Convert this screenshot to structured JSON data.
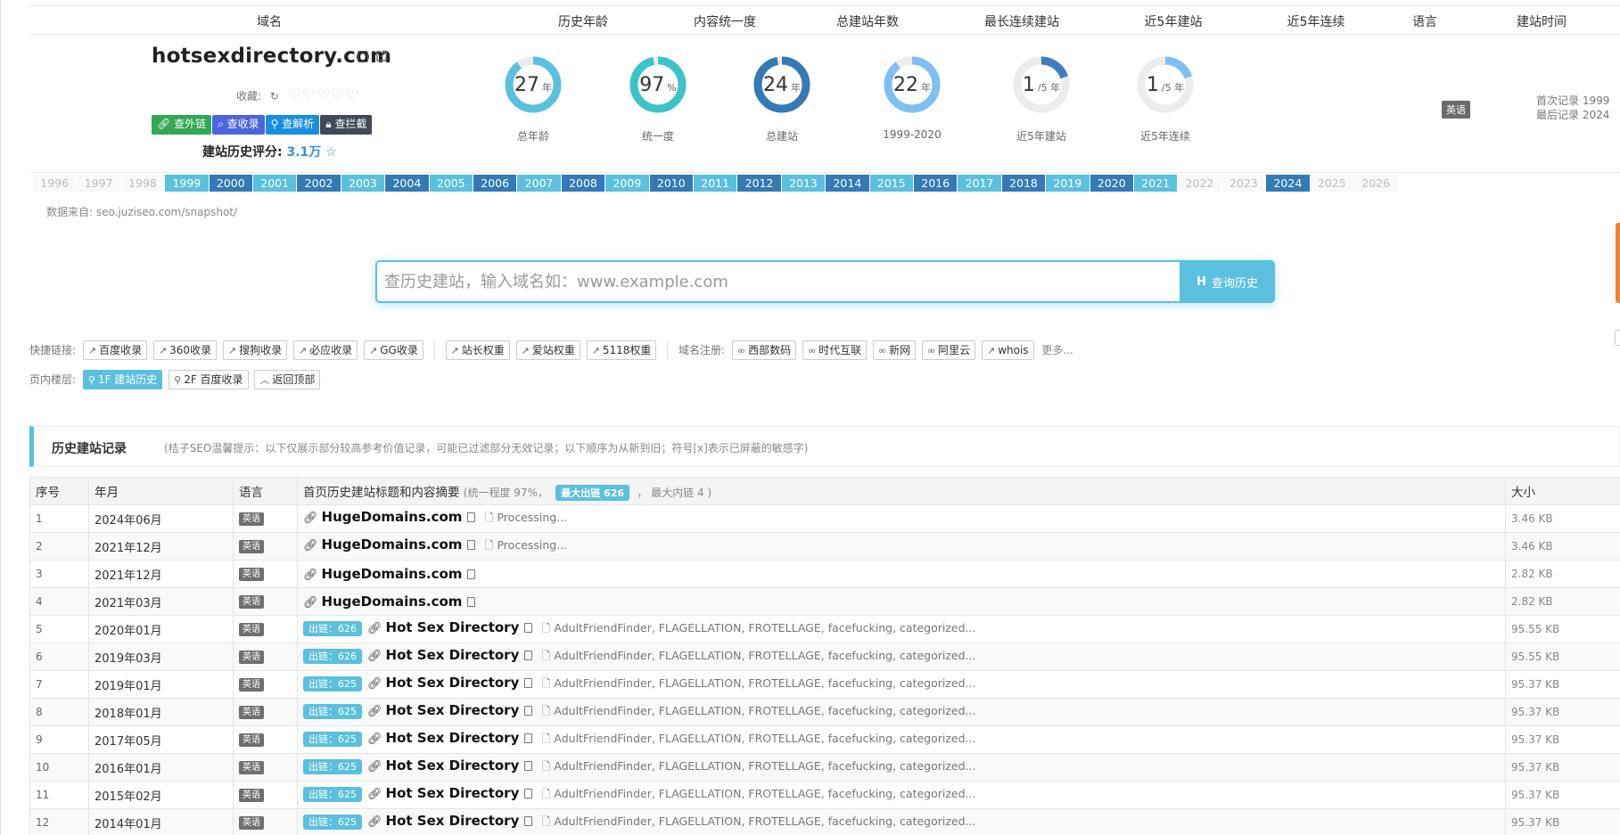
{
  "header": {
    "columns": [
      "域名",
      "历史年龄",
      "内容统一度",
      "总建站年数",
      "最长连续建站",
      "近5年建站",
      "近5年连续",
      "语言",
      "建站时间"
    ],
    "domain": "hotsexdirectory.com",
    "fav_label": "收藏:",
    "hearts": "♡♡♡♡♡",
    "buttons": [
      "查外链",
      "查收录",
      "查解析",
      "查拦截"
    ],
    "score_label": "建站历史评分:",
    "score_value": "3.1万",
    "stats": [
      {
        "num": "27",
        "unit": "年",
        "caption": "总年龄",
        "fraction": 0.9,
        "color": "#5bc0de"
      },
      {
        "num": "97",
        "unit": "%",
        "caption": "统一度",
        "fraction": 0.97,
        "color": "#3cc3c8"
      },
      {
        "num": "24",
        "unit": "年",
        "caption": "总建站",
        "fraction": 0.97,
        "color": "#337ab7"
      },
      {
        "num": "22",
        "unit": "年",
        "caption": "1999-2020",
        "fraction": 0.9,
        "color": "#7fc0f2"
      },
      {
        "num": "1",
        "unit": "/5 年",
        "caption": "近5年建站",
        "fraction": 0.2,
        "color": "#3d7fc2"
      },
      {
        "num": "1",
        "unit": "/5 年",
        "caption": "近5年连续",
        "fraction": 0.2,
        "color": "#7fc0f2"
      }
    ],
    "language": "英语",
    "first_record": "首次记录 1999",
    "last_record": "最后记录 2024"
  },
  "years": [
    {
      "y": "1996",
      "s": "off"
    },
    {
      "y": "1997",
      "s": "off"
    },
    {
      "y": "1998",
      "s": "off"
    },
    {
      "y": "1999",
      "s": "l"
    },
    {
      "y": "2000",
      "s": "d"
    },
    {
      "y": "2001",
      "s": "l"
    },
    {
      "y": "2002",
      "s": "d"
    },
    {
      "y": "2003",
      "s": "l"
    },
    {
      "y": "2004",
      "s": "d"
    },
    {
      "y": "2005",
      "s": "l"
    },
    {
      "y": "2006",
      "s": "d"
    },
    {
      "y": "2007",
      "s": "l"
    },
    {
      "y": "2008",
      "s": "d"
    },
    {
      "y": "2009",
      "s": "l"
    },
    {
      "y": "2010",
      "s": "d"
    },
    {
      "y": "2011",
      "s": "l"
    },
    {
      "y": "2012",
      "s": "d"
    },
    {
      "y": "2013",
      "s": "l"
    },
    {
      "y": "2014",
      "s": "d"
    },
    {
      "y": "2015",
      "s": "l"
    },
    {
      "y": "2016",
      "s": "d"
    },
    {
      "y": "2017",
      "s": "l"
    },
    {
      "y": "2018",
      "s": "d"
    },
    {
      "y": "2019",
      "s": "l"
    },
    {
      "y": "2020",
      "s": "d"
    },
    {
      "y": "2021",
      "s": "l"
    },
    {
      "y": "2022",
      "s": "off"
    },
    {
      "y": "2023",
      "s": "off"
    },
    {
      "y": "2024",
      "s": "d"
    },
    {
      "y": "2025",
      "s": "off"
    },
    {
      "y": "2026",
      "s": "off"
    }
  ],
  "source": "数据来自: seo.juziseo.com/snapshot/",
  "search": {
    "placeholder": "查历史建站，输入域名如：www.example.com",
    "button": "查询历史"
  },
  "quick": {
    "label": "快捷链接:",
    "group1": [
      "百度收录",
      "360收录",
      "搜狗收录",
      "必应收录",
      "GG收录"
    ],
    "group2": [
      "站长权重",
      "爱站权重",
      "5118权重"
    ],
    "reg_label": "域名注册:",
    "group3": [
      "西部数码",
      "时代互联",
      "新网",
      "阿里云",
      "whois"
    ],
    "more": "更多..."
  },
  "floors": {
    "label": "页内楼层:",
    "items": [
      "1F 建站历史",
      "2F 百度收录",
      "返回顶部"
    ]
  },
  "section": {
    "title": "历史建站记录",
    "tip": "(桔子SEO温馨提示：以下仅展示部分较高参考价值记录，可能已过滤部分无效记录；以下顺序为从新到旧；符号[x]表示已屏蔽的敏感字)"
  },
  "table": {
    "headers": [
      "序号",
      "年月",
      "语言",
      "首页历史建站标题和内容摘要",
      "大小"
    ],
    "header_sub1": "(统一程度 97%，",
    "header_badge": "最大出链 626",
    "header_sub2": "，  最大内链 4 )",
    "rows": [
      {
        "n": "1",
        "date": "2024年06月",
        "lang": "英语",
        "out": "",
        "title": "HugeDomains.com",
        "summary": "Processing...",
        "size": "3.46 KB"
      },
      {
        "n": "2",
        "date": "2021年12月",
        "lang": "英语",
        "out": "",
        "title": "HugeDomains.com",
        "summary": "Processing...",
        "size": "3.46 KB"
      },
      {
        "n": "3",
        "date": "2021年12月",
        "lang": "英语",
        "out": "",
        "title": "HugeDomains.com",
        "summary": "",
        "size": "2.82 KB"
      },
      {
        "n": "4",
        "date": "2021年03月",
        "lang": "英语",
        "out": "",
        "title": "HugeDomains.com",
        "summary": "",
        "size": "2.82 KB"
      },
      {
        "n": "5",
        "date": "2020年01月",
        "lang": "英语",
        "out": "出链：626",
        "title": "Hot Sex Directory",
        "summary": "AdultFriendFinder, FLAGELLATION, FROTELLAGE, facefucking, categorized...",
        "size": "95.55 KB"
      },
      {
        "n": "6",
        "date": "2019年03月",
        "lang": "英语",
        "out": "出链：626",
        "title": "Hot Sex Directory",
        "summary": "AdultFriendFinder, FLAGELLATION, FROTELLAGE, facefucking, categorized...",
        "size": "95.55 KB"
      },
      {
        "n": "7",
        "date": "2019年01月",
        "lang": "英语",
        "out": "出链：625",
        "title": "Hot Sex Directory",
        "summary": "AdultFriendFinder, FLAGELLATION, FROTELLAGE, facefucking, categorized...",
        "size": "95.37 KB"
      },
      {
        "n": "8",
        "date": "2018年01月",
        "lang": "英语",
        "out": "出链：625",
        "title": "Hot Sex Directory",
        "summary": "AdultFriendFinder, FLAGELLATION, FROTELLAGE, facefucking, categorized...",
        "size": "95.37 KB"
      },
      {
        "n": "9",
        "date": "2017年05月",
        "lang": "英语",
        "out": "出链：625",
        "title": "Hot Sex Directory",
        "summary": "AdultFriendFinder, FLAGELLATION, FROTELLAGE, facefucking, categorized...",
        "size": "95.37 KB"
      },
      {
        "n": "10",
        "date": "2016年01月",
        "lang": "英语",
        "out": "出链：625",
        "title": "Hot Sex Directory",
        "summary": "AdultFriendFinder, FLAGELLATION, FROTELLAGE, facefucking, categorized...",
        "size": "95.37 KB"
      },
      {
        "n": "11",
        "date": "2015年02月",
        "lang": "英语",
        "out": "出链：625",
        "title": "Hot Sex Directory",
        "summary": "AdultFriendFinder, FLAGELLATION, FROTELLAGE, facefucking, categorized...",
        "size": "95.37 KB"
      },
      {
        "n": "12",
        "date": "2014年01月",
        "lang": "英语",
        "out": "出链：625",
        "title": "Hot Sex Directory",
        "summary": "AdultFriendFinder, FLAGELLATION, FROTELLAGE, facefucking, categorized...",
        "size": "95.37 KB"
      }
    ]
  }
}
